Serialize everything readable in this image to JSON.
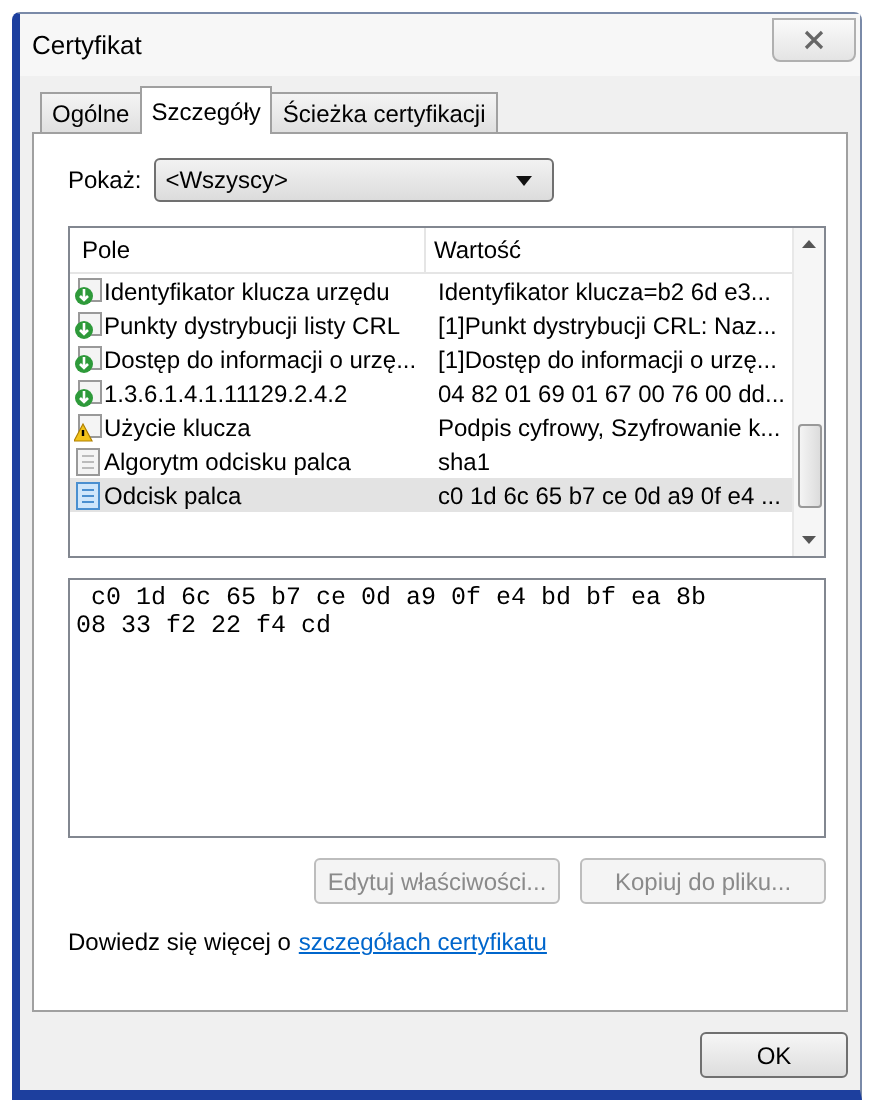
{
  "window": {
    "title": "Certyfikat"
  },
  "tabs": [
    {
      "label": "Ogólne",
      "selected": false
    },
    {
      "label": "Szczegóły",
      "selected": true
    },
    {
      "label": "Ścieżka certyfikacji",
      "selected": false
    }
  ],
  "show": {
    "label": "Pokaż:",
    "value": "<Wszyscy>"
  },
  "table": {
    "columns": [
      "Pole",
      "Wartość"
    ],
    "rows": [
      {
        "kind": "extension",
        "field": "Identyfikator klucza urzędu",
        "value": "Identyfikator klucza=b2 6d e3...",
        "selected": false
      },
      {
        "kind": "extension",
        "field": "Punkty dystrybucji listy CRL",
        "value": "[1]Punkt dystrybucji CRL: Naz...",
        "selected": false
      },
      {
        "kind": "extension",
        "field": "Dostęp do informacji o urzę...",
        "value": "[1]Dostęp do informacji o urzę...",
        "selected": false
      },
      {
        "kind": "extension",
        "field": "1.3.6.1.4.1.11129.2.4.2",
        "value": "04 82 01 69 01 67 00 76 00 dd...",
        "selected": false
      },
      {
        "kind": "critical",
        "field": "Użycie klucza",
        "value": "Podpis cyfrowy, Szyfrowanie k...",
        "selected": false
      },
      {
        "kind": "property",
        "field": "Algorytm odcisku palca",
        "value": "sha1",
        "selected": false
      },
      {
        "kind": "property",
        "field": "Odcisk palca",
        "value": "c0 1d 6c 65 b7 ce 0d a9 0f e4 ...",
        "selected": true
      }
    ]
  },
  "detail": {
    "lines": [
      " c0 1d 6c 65 b7 ce 0d a9 0f e4 bd bf ea 8b",
      "08 33 f2 22 f4 cd"
    ]
  },
  "buttons": [
    {
      "label": "Edytuj właściwości...",
      "disabled": true
    },
    {
      "label": "Kopiuj do pliku...",
      "disabled": true
    }
  ],
  "learn_more": {
    "text": "Dowiedz się więcej o",
    "link": "szczegółach certyfikatu"
  },
  "ok_button": {
    "label": "OK"
  }
}
